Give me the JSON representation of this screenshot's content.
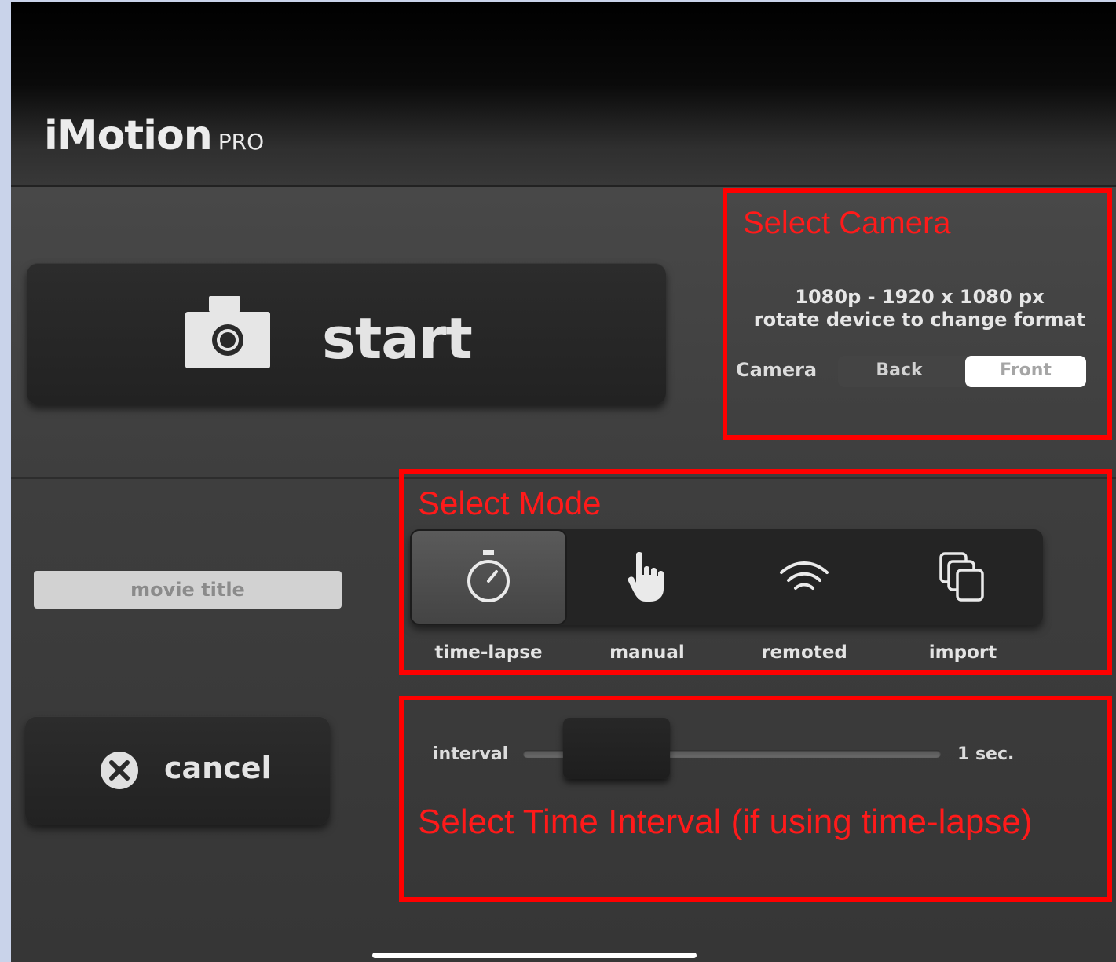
{
  "app": {
    "title_main": "iMotion",
    "title_sub": "PRO"
  },
  "start_button": {
    "label": "start",
    "icon": "camera-icon"
  },
  "movie_title": {
    "placeholder": "movie title",
    "value": ""
  },
  "cancel_button": {
    "label": "cancel",
    "icon": "close-circle-icon"
  },
  "camera": {
    "format_line1": "1080p - 1920 x 1080 px",
    "format_line2": "rotate device to change format",
    "label": "Camera",
    "options": [
      "Back",
      "Front"
    ],
    "selected": "Front"
  },
  "modes": {
    "items": [
      {
        "label": "time-lapse",
        "icon": "stopwatch-icon"
      },
      {
        "label": "manual",
        "icon": "hand-pointer-icon"
      },
      {
        "label": "remoted",
        "icon": "wifi-icon"
      },
      {
        "label": "import",
        "icon": "copy-icon"
      }
    ],
    "selected": "time-lapse"
  },
  "interval": {
    "label": "interval",
    "value_text": "1 sec."
  },
  "annotations": {
    "camera": "Select Camera",
    "mode": "Select Mode",
    "interval": "Select Time Interval (if using time-lapse)"
  },
  "colors": {
    "annotation": "#ff0000",
    "background": "#3d3d3d",
    "accent_text": "#e4e4e4"
  }
}
